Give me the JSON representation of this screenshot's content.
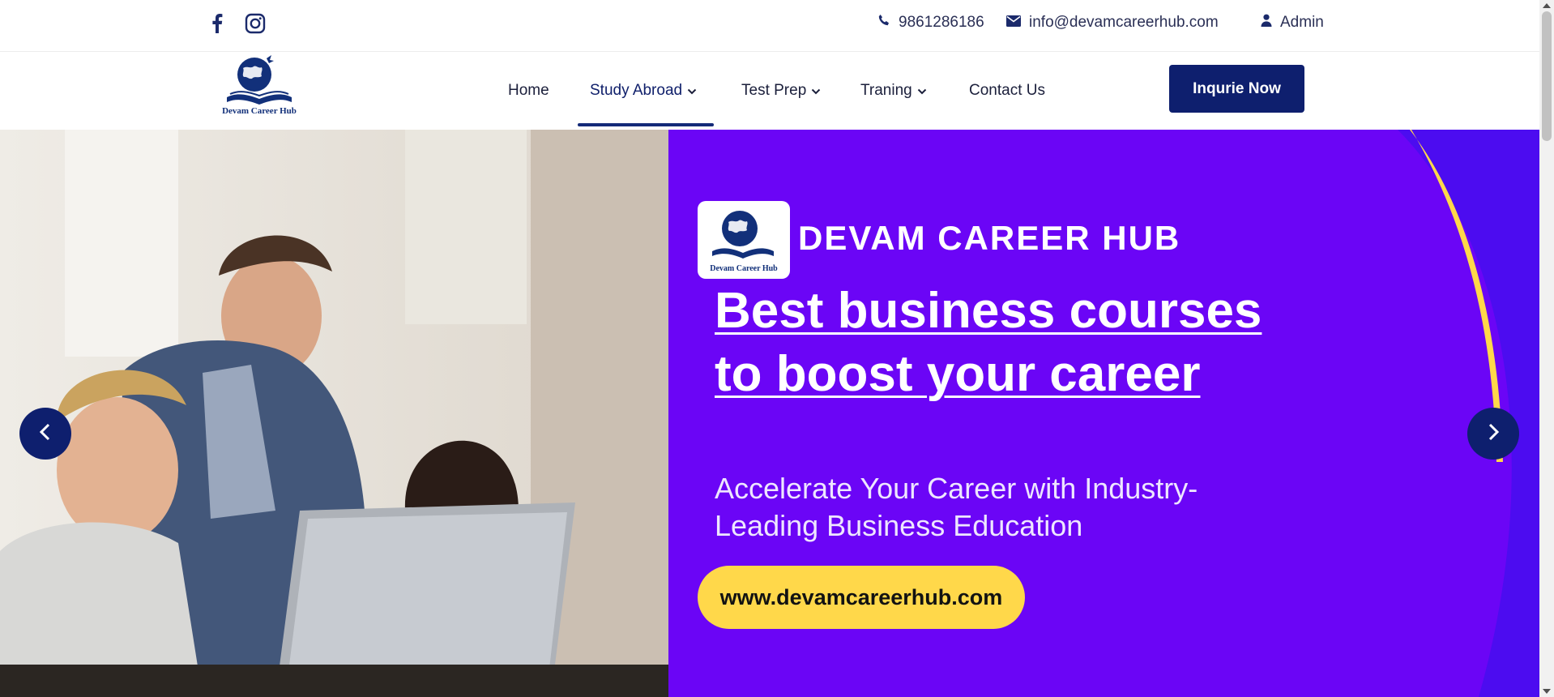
{
  "topbar": {
    "social": [
      {
        "icon": "facebook-icon"
      },
      {
        "icon": "instagram-icon"
      }
    ],
    "phone": "9861286186",
    "email": "info@devamcareerhub.com",
    "account": "Admin"
  },
  "logo": {
    "text": "Devam Career Hub"
  },
  "nav": {
    "items": [
      {
        "label": "Home",
        "dropdown": false
      },
      {
        "label": "Study Abroad",
        "dropdown": true,
        "active": true
      },
      {
        "label": "Test Prep",
        "dropdown": true
      },
      {
        "label": "Traning",
        "dropdown": true
      },
      {
        "label": "Contact Us",
        "dropdown": false
      }
    ],
    "cta": "Inqurie Now"
  },
  "hero": {
    "brand_logo_text": "Devam Career Hub",
    "brand_name": "DEVAM CAREER HUB",
    "headline_line1": "Best business courses",
    "headline_line2": "to boost your career",
    "subline": "Accelerate Your Career with Industry-Leading Business Education",
    "website": "www.devamcareerhub.com",
    "prev_icon": "chevron-left-icon",
    "next_icon": "chevron-right-icon"
  },
  "colors": {
    "navy": "#0e1f6e",
    "purple": "#6b05f6",
    "yellow": "#ffd84a"
  }
}
